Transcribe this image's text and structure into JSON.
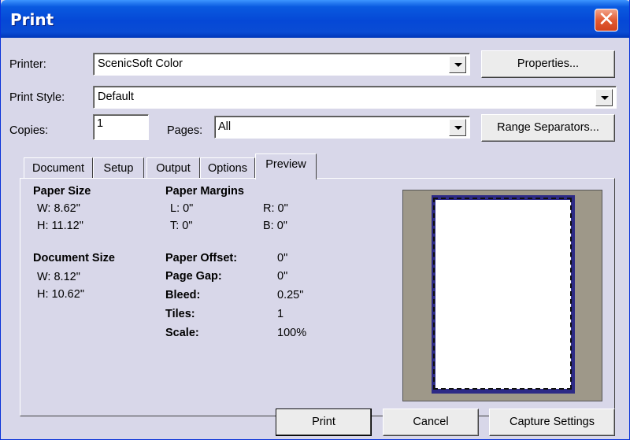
{
  "window": {
    "title": "Print"
  },
  "printer": {
    "label": "Printer:",
    "value": "ScenicSoft Color",
    "properties_label": "Properties..."
  },
  "print_style": {
    "label": "Print Style:",
    "value": "Default"
  },
  "copies": {
    "label": "Copies:",
    "value": "1"
  },
  "pages": {
    "label": "Pages:",
    "value": "All",
    "range_label": "Range Separators..."
  },
  "tabs": [
    {
      "label": "Document"
    },
    {
      "label": "Setup"
    },
    {
      "label": "Output"
    },
    {
      "label": "Options"
    },
    {
      "label": "Preview",
      "active": true
    }
  ],
  "preview": {
    "paper_size": {
      "heading": "Paper Size",
      "w": "W: 8.62\"",
      "h": "H: 11.12\""
    },
    "document_size": {
      "heading": "Document Size",
      "w": "W: 8.12\"",
      "h": "H: 10.62\""
    },
    "paper_margins": {
      "heading": "Paper Margins",
      "l": "L: 0\"",
      "r": "R: 0\"",
      "t": "T: 0\"",
      "b": "B: 0\""
    },
    "paper_offset": {
      "label": "Paper Offset:",
      "value": "0\""
    },
    "page_gap": {
      "label": "Page Gap:",
      "value": "0\""
    },
    "bleed": {
      "label": "Bleed:",
      "value": "0.25\""
    },
    "tiles": {
      "label": "Tiles:",
      "value": "1"
    },
    "scale": {
      "label": "Scale:",
      "value": "100%"
    }
  },
  "buttons": {
    "print": "Print",
    "cancel": "Cancel",
    "capture": "Capture Settings"
  },
  "colors": {
    "titlebar": "#0548d6",
    "dialog_bg": "#d8d7e9",
    "close": "#e35b32",
    "preview_bg": "#9e9889",
    "sheet_border": "#2d2a86"
  }
}
